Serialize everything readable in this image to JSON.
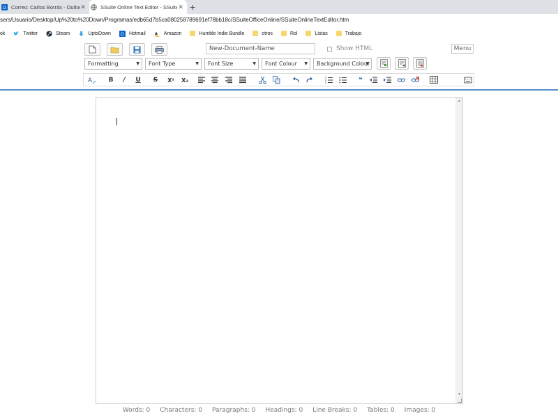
{
  "browser": {
    "tabs": [
      {
        "title": "Correo: Carlos Borrás - Outlook",
        "icon": "outlook-icon"
      },
      {
        "title": "SSuite Online Text Editor - SSuite",
        "icon": "globe-icon"
      }
    ],
    "address": "sers/Usuario/Desktop/Up%20to%20Down/Programas/edb65d7b5ca080258789691ef78bb18c/SSuiteOfficeOnline/SSuiteOnlineTextEditor.htm",
    "bookmarks": [
      {
        "label": "ok",
        "icon": "outlook-icon"
      },
      {
        "label": "Twitter",
        "icon": "twitter-icon"
      },
      {
        "label": "Steam",
        "icon": "steam-icon"
      },
      {
        "label": "UptoDown",
        "icon": "uptodown-icon"
      },
      {
        "label": "Hotmail",
        "icon": "hotmail-icon"
      },
      {
        "label": "Amazon",
        "icon": "amazon-icon"
      },
      {
        "label": "Humble Indie Bundle",
        "icon": "folder-icon"
      },
      {
        "label": "otros",
        "icon": "folder-icon"
      },
      {
        "label": "Rol",
        "icon": "folder-icon"
      },
      {
        "label": "Listas",
        "icon": "folder-icon"
      },
      {
        "label": "Trabajo",
        "icon": "folder-icon"
      }
    ]
  },
  "toolbar": {
    "doc_name_placeholder": "New-Document-Name",
    "show_html_label": "Show HTML",
    "menu_label": "Menu",
    "selects": {
      "formatting": "Formatting",
      "font_type": "Font Type",
      "font_size": "Font Size",
      "font_colour": "Font Colour",
      "background_colour": "Background Colour"
    },
    "format_glyphs": {
      "bold": "B",
      "italic": "/",
      "underline": "U",
      "strike": "S",
      "superscript": "X²",
      "subscript": "X₂",
      "quote": "❝"
    }
  },
  "status": {
    "words": "Words: 0",
    "characters": "Characters: 0",
    "paragraphs": "Paragraphs: 0",
    "headings": "Headings: 0",
    "line_breaks": "Line Breaks: 0",
    "tables": "Tables: 0",
    "images": "Images: 0"
  },
  "colors": {
    "accent_line": "#5a8fcb",
    "tab_strip": "#dee1e6"
  }
}
